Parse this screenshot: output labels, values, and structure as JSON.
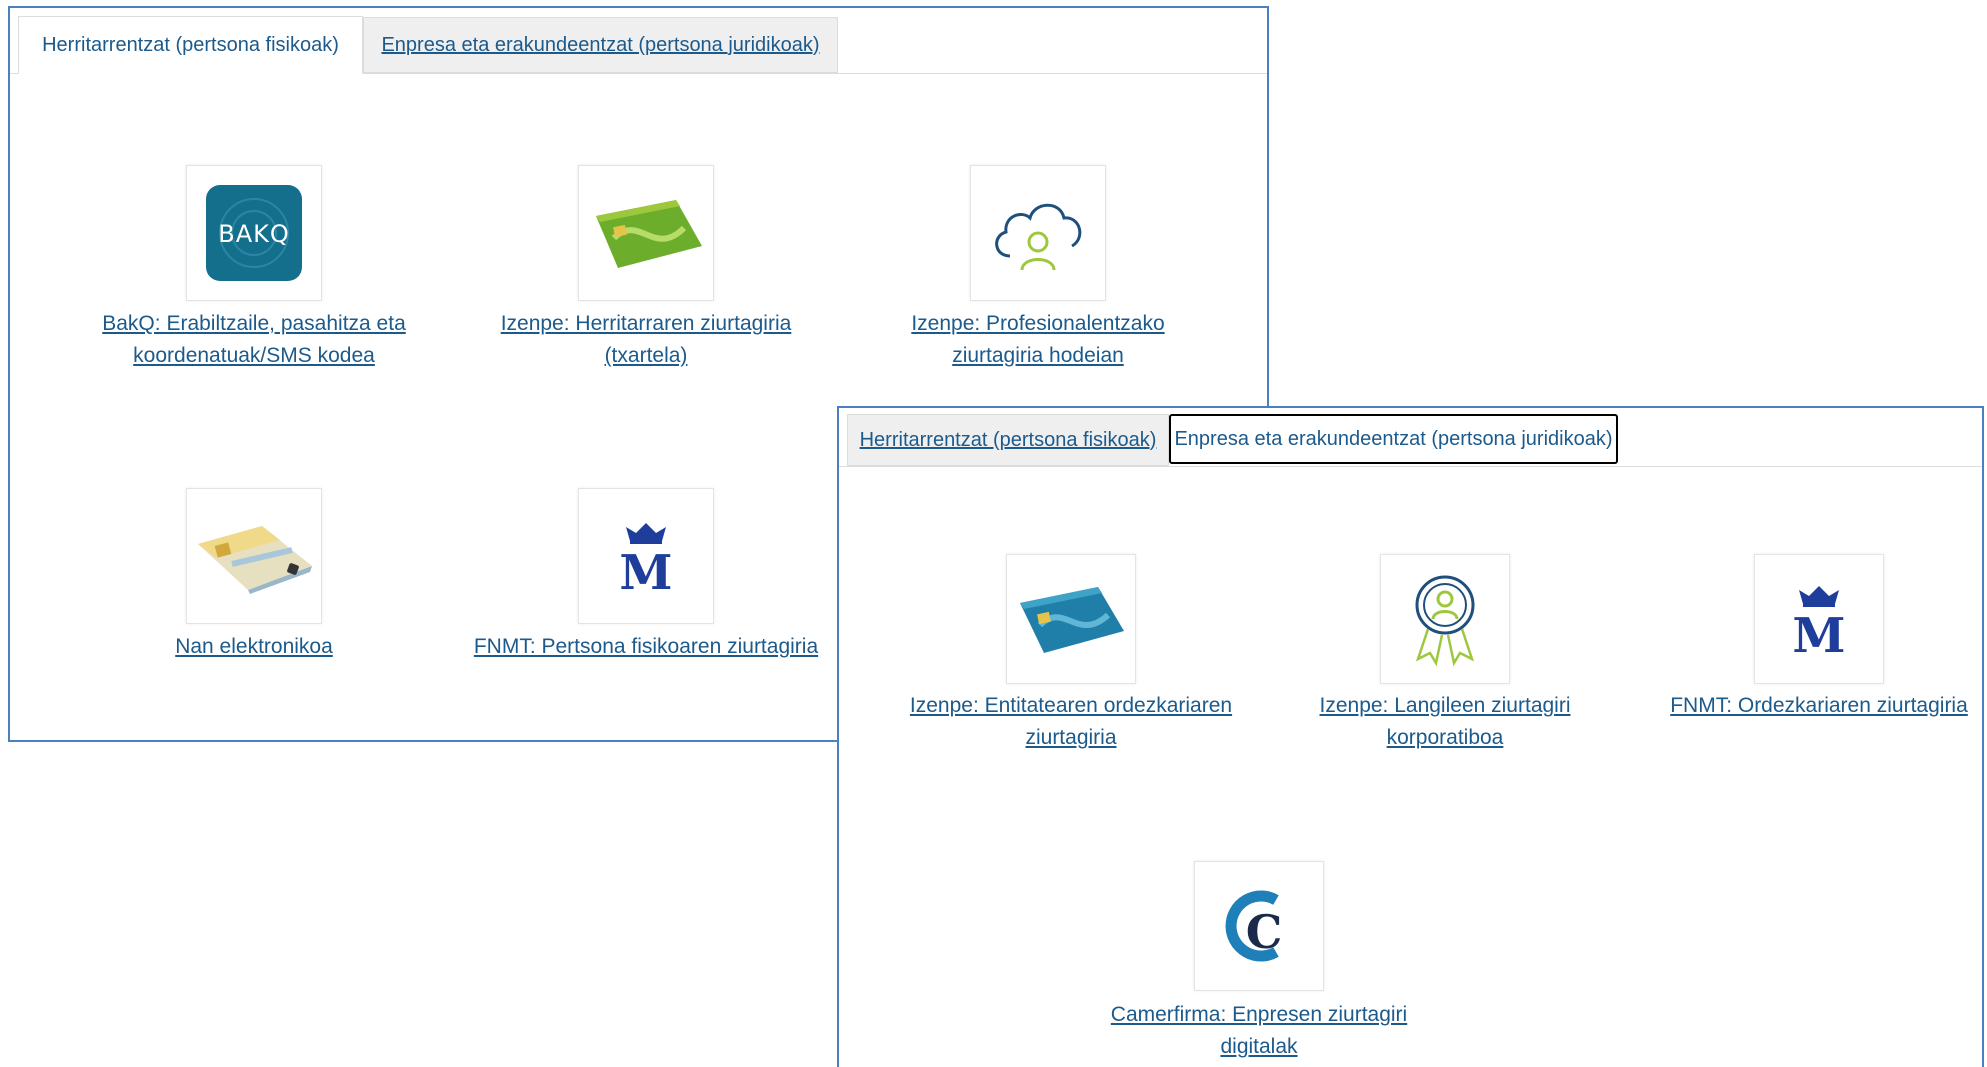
{
  "panel_citizens": {
    "tabs": [
      {
        "label": "Herritarrentzat (pertsona fisikoak)",
        "state": "active"
      },
      {
        "label": "Enpresa eta erakundeentzat (pertsona juridikoak)",
        "state": "inactive"
      }
    ],
    "items": [
      {
        "label_lines": [
          "BakQ: Erabiltzaile, pasahitza eta",
          "koordenatuak/SMS kodea"
        ],
        "icon": "bakq-logo-icon",
        "logo_text": "BAKQ"
      },
      {
        "label_lines": [
          "Izenpe: Herritarraren ziurtagiria",
          "(txartela)"
        ],
        "icon": "green-id-card-icon"
      },
      {
        "label_lines": [
          "Izenpe: Profesionalentzako",
          "ziurtagiria hodeian"
        ],
        "icon": "cloud-user-icon"
      },
      {
        "label_lines": [
          "Nan elektronikoa"
        ],
        "icon": "dni-card-icon"
      },
      {
        "label_lines": [
          "FNMT: Pertsona fisikoaren ziurtagiria"
        ],
        "icon": "fnmt-crown-icon",
        "logo_text": "M"
      }
    ]
  },
  "panel_companies": {
    "tabs": [
      {
        "label": "Herritarrentzat (pertsona fisikoak)",
        "state": "inactive"
      },
      {
        "label": "Enpresa eta erakundeentzat (pertsona juridikoak)",
        "state": "focused"
      }
    ],
    "items": [
      {
        "label_lines": [
          "Izenpe: Entitatearen ordezkariaren",
          "ziurtagiria"
        ],
        "icon": "blue-id-card-icon"
      },
      {
        "label_lines": [
          "Izenpe: Langileen ziurtagiri",
          "korporatiboa"
        ],
        "icon": "award-badge-icon"
      },
      {
        "label_lines": [
          "FNMT: Ordezkariaren ziurtagiria"
        ],
        "icon": "fnmt-crown-icon",
        "logo_text": "M"
      },
      {
        "label_lines": [
          "Camerfirma: Enpresen ziurtagiri",
          "digitalak"
        ],
        "icon": "camerfirma-logo-icon",
        "logo_text": "C"
      }
    ]
  },
  "colors": {
    "link": "#1c5a8c",
    "panel_border": "#4a7fc1",
    "bakq_teal": "#146f8c",
    "fnmt_blue": "#1f3e9c",
    "izenpe_green": "#9dc83d"
  }
}
